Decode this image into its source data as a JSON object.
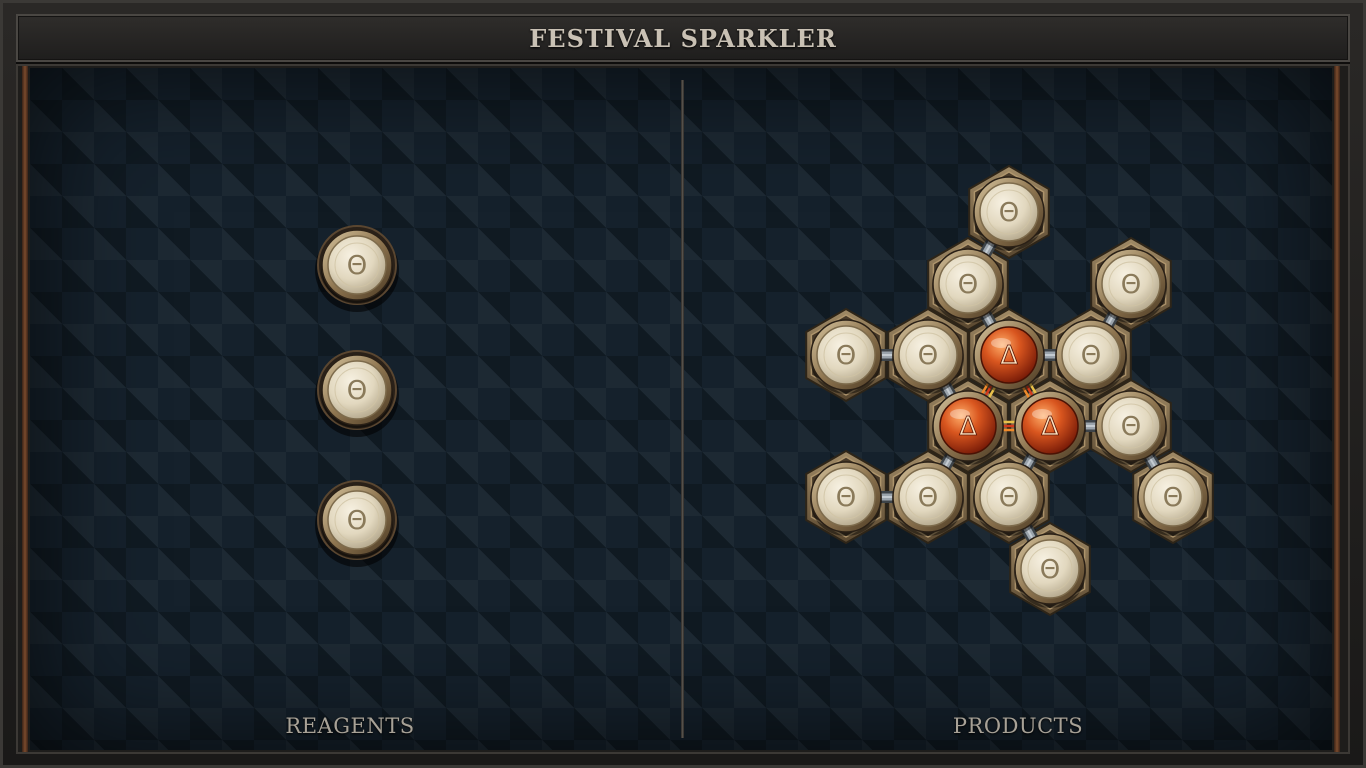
{
  "title": "FESTIVAL SPARKLER",
  "panels": {
    "reagents_label": "REAGENTS",
    "products_label": "PRODUCTS"
  },
  "symbols": {
    "salt": "Θ",
    "fire": "Δ"
  },
  "colors": {
    "salt_atom": "#e6ddc6",
    "fire_atom": "#c8501e",
    "hex_plate": "#8a7556",
    "bond": "#9aa3ab",
    "fire_bond": "#e0a040"
  },
  "reagents": [
    {
      "element": "salt",
      "count": 1
    },
    {
      "element": "salt",
      "count": 1
    },
    {
      "element": "salt",
      "count": 1
    }
  ],
  "product": {
    "atoms": [
      {
        "element": "salt"
      },
      {
        "element": "salt"
      },
      {
        "element": "salt"
      },
      {
        "element": "salt"
      },
      {
        "element": "salt"
      },
      {
        "element": "fire"
      },
      {
        "element": "salt"
      },
      {
        "element": "fire"
      },
      {
        "element": "fire"
      },
      {
        "element": "salt"
      },
      {
        "element": "salt"
      },
      {
        "element": "salt"
      },
      {
        "element": "salt"
      },
      {
        "element": "salt"
      },
      {
        "element": "salt"
      }
    ],
    "bonds": [
      {
        "a": 0,
        "b": 1,
        "type": "normal"
      },
      {
        "a": 1,
        "b": 5,
        "type": "normal"
      },
      {
        "a": 2,
        "b": 6,
        "type": "normal"
      },
      {
        "a": 3,
        "b": 4,
        "type": "normal"
      },
      {
        "a": 4,
        "b": 7,
        "type": "normal"
      },
      {
        "a": 5,
        "b": 6,
        "type": "normal"
      },
      {
        "a": 5,
        "b": 7,
        "type": "triplex"
      },
      {
        "a": 5,
        "b": 8,
        "type": "triplex"
      },
      {
        "a": 7,
        "b": 8,
        "type": "triplex"
      },
      {
        "a": 7,
        "b": 12,
        "type": "normal"
      },
      {
        "a": 8,
        "b": 9,
        "type": "normal"
      },
      {
        "a": 8,
        "b": 13,
        "type": "normal"
      },
      {
        "a": 9,
        "b": 10,
        "type": "normal"
      },
      {
        "a": 11,
        "b": 12,
        "type": "normal"
      },
      {
        "a": 13,
        "b": 14,
        "type": "normal"
      }
    ]
  }
}
